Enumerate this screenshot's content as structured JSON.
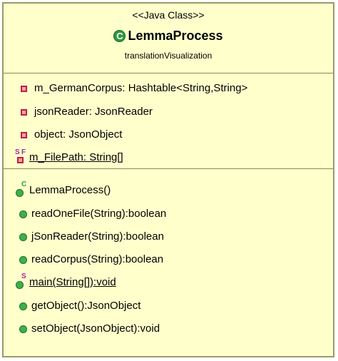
{
  "class_box": {
    "stereotype": "<<Java Class>>",
    "class_icon_glyph": "C",
    "name": "LemmaProcess",
    "package": "translationVisualization",
    "colors": {
      "fill": "#ffffcc",
      "border": "#9a9a6a",
      "private_icon": "#c0203c",
      "public_icon": "#3fae4c",
      "static_modifier": "#b0209a"
    }
  },
  "attributes": [
    {
      "text": "m_GermanCorpus: Hashtable<String,String>",
      "visibility": "private",
      "static": false,
      "final": false
    },
    {
      "text": "jsonReader: JsonReader",
      "visibility": "private",
      "static": false,
      "final": false
    },
    {
      "text": "object: JsonObject",
      "visibility": "private",
      "static": false,
      "final": false
    },
    {
      "text": "m_FilePath: String[]",
      "visibility": "private",
      "static": true,
      "final": true,
      "modifier_s": "S",
      "modifier_f": "F"
    }
  ],
  "operations": [
    {
      "text": "LemmaProcess()",
      "visibility": "public",
      "constructor": true,
      "modifier_c": "C"
    },
    {
      "text": "readOneFile(String):boolean",
      "visibility": "public"
    },
    {
      "text": "jSonReader(String):boolean",
      "visibility": "public"
    },
    {
      "text": "readCorpus(String):boolean",
      "visibility": "public"
    },
    {
      "text": "main(String[]):void",
      "visibility": "public",
      "static": true,
      "modifier_s": "S"
    },
    {
      "text": "getObject():JsonObject",
      "visibility": "public"
    },
    {
      "text": "setObject(JsonObject):void",
      "visibility": "public"
    }
  ]
}
